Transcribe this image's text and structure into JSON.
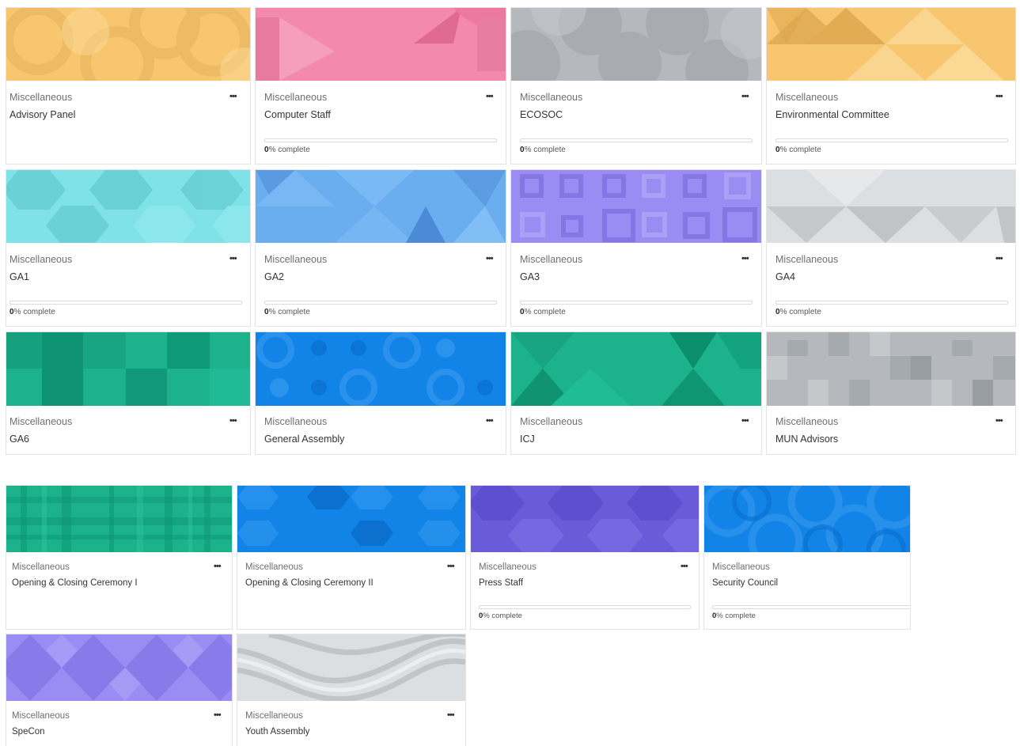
{
  "colors": {
    "orange": "#f8c66e",
    "pink": "#f38aad",
    "gray": "#b5b9bd",
    "cyan": "#7ee2e6",
    "blue": "#6aaef0",
    "violet": "#9a8cf3",
    "lightgray": "#dcdfe1",
    "green": "#1cb38c",
    "brightblue": "#1284e8",
    "purple": "#6a5cd9"
  },
  "progress_suffix": "% complete",
  "cards": [
    {
      "category": "Miscellaneous",
      "title": "Advisory Panel",
      "menu_label": "•••",
      "progress_value": ""
    },
    {
      "category": "Miscellaneous",
      "title": "Computer Staff",
      "menu_label": "•••",
      "progress_value": "0"
    },
    {
      "category": "Miscellaneous",
      "title": "ECOSOC",
      "menu_label": "•••",
      "progress_value": "0"
    },
    {
      "category": "Miscellaneous",
      "title": "Environmental Committee",
      "menu_label": "•••",
      "progress_value": "0"
    },
    {
      "category": "Miscellaneous",
      "title": "GA1",
      "menu_label": "•••",
      "progress_value": "0"
    },
    {
      "category": "Miscellaneous",
      "title": "GA2",
      "menu_label": "•••",
      "progress_value": "0"
    },
    {
      "category": "Miscellaneous",
      "title": "GA3",
      "menu_label": "•••",
      "progress_value": "0"
    },
    {
      "category": "Miscellaneous",
      "title": "GA4",
      "menu_label": "•••",
      "progress_value": "0"
    },
    {
      "category": "Miscellaneous",
      "title": "GA6",
      "menu_label": "•••",
      "progress_value": ""
    },
    {
      "category": "Miscellaneous",
      "title": "General Assembly",
      "menu_label": "•••",
      "progress_value": ""
    },
    {
      "category": "Miscellaneous",
      "title": "ICJ",
      "menu_label": "•••",
      "progress_value": ""
    },
    {
      "category": "Miscellaneous",
      "title": "MUN Advisors",
      "menu_label": "•••",
      "progress_value": ""
    },
    {
      "category": "Miscellaneous",
      "title": "Opening & Closing Ceremony I",
      "menu_label": "•••",
      "progress_value": ""
    },
    {
      "category": "Miscellaneous",
      "title": "Opening & Closing Ceremony II",
      "menu_label": "•••",
      "progress_value": ""
    },
    {
      "category": "Miscellaneous",
      "title": "Press Staff",
      "menu_label": "•••",
      "progress_value": "0"
    },
    {
      "category": "Miscellaneous",
      "title": "Security Council",
      "menu_label": "•••",
      "progress_value": "0"
    },
    {
      "category": "Miscellaneous",
      "title": "SpeCon",
      "menu_label": "•••",
      "progress_value": ""
    },
    {
      "category": "Miscellaneous",
      "title": "Youth Assembly",
      "menu_label": "•••",
      "progress_value": ""
    }
  ]
}
